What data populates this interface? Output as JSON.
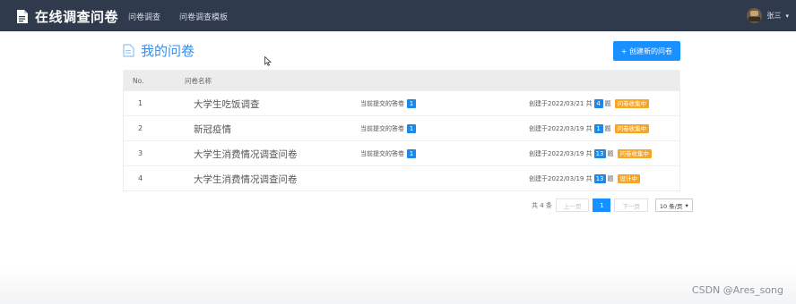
{
  "header": {
    "title": "在线调查问卷",
    "nav": [
      "问卷调查",
      "问卷调查模板"
    ],
    "user_name": "张三",
    "user_caret": "▾"
  },
  "page": {
    "title": "我的问卷",
    "create_button": "+ 创建新的问卷"
  },
  "table": {
    "columns": [
      "No.",
      "问卷名称"
    ],
    "rows": [
      {
        "no": "1",
        "name": "大学生吃饭调查",
        "submitted_label": "当前提交的答卷",
        "submitted_count": "1",
        "created_prefix": "创建于2022/03/21 共",
        "question_count": "4",
        "question_suffix": "题",
        "status": "问卷收集中"
      },
      {
        "no": "2",
        "name": "新冠疫情",
        "submitted_label": "当前提交的答卷",
        "submitted_count": "1",
        "created_prefix": "创建于2022/03/19 共",
        "question_count": "1",
        "question_suffix": "题",
        "status": "问卷收集中"
      },
      {
        "no": "3",
        "name": "大学生消费情况调查问卷",
        "submitted_label": "当前提交的答卷",
        "submitted_count": "1",
        "created_prefix": "创建于2022/03/19 共",
        "question_count": "13",
        "question_suffix": "题",
        "status": "问卷收集中"
      },
      {
        "no": "4",
        "name": "大学生消费情况调查问卷",
        "submitted_label": "",
        "submitted_count": "",
        "created_prefix": "创建于2022/03/19 共",
        "question_count": "13",
        "question_suffix": "题",
        "status": "设计中"
      }
    ]
  },
  "pagination": {
    "total": "共 4 条",
    "prev": "上一页",
    "current": "1",
    "next": "下一页",
    "page_size": "10 条/页"
  },
  "watermark": "CSDN @Ares_song",
  "colors": {
    "topbar": "#2f3b4d",
    "accent": "#1890ff",
    "status": "#f6a623"
  }
}
